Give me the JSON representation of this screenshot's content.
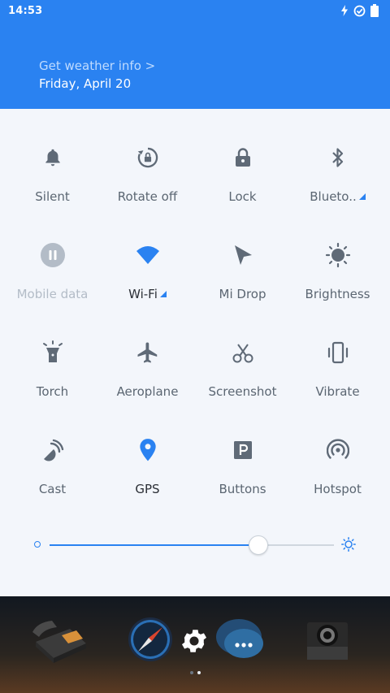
{
  "status_bar": {
    "time": "14:53"
  },
  "header": {
    "weather_link": "Get weather info >",
    "date": "Friday, April 20"
  },
  "tiles": [
    {
      "label": "Silent",
      "icon": "bell-icon",
      "state": "off"
    },
    {
      "label": "Rotate off",
      "icon": "rotate-lock-icon",
      "state": "off"
    },
    {
      "label": "Lock",
      "icon": "padlock-icon",
      "state": "off"
    },
    {
      "label": "Blueto..",
      "icon": "bluetooth-icon",
      "state": "off",
      "expandable": true
    },
    {
      "label": "Mobile data",
      "icon": "mobile-data-icon",
      "state": "disabled"
    },
    {
      "label": "Wi-Fi",
      "icon": "wifi-icon",
      "state": "on",
      "expandable": true
    },
    {
      "label": "Mi Drop",
      "icon": "mi-drop-icon",
      "state": "off"
    },
    {
      "label": "Brightness",
      "icon": "brightness-icon",
      "state": "off"
    },
    {
      "label": "Torch",
      "icon": "torch-icon",
      "state": "off"
    },
    {
      "label": "Aeroplane",
      "icon": "aeroplane-icon",
      "state": "off"
    },
    {
      "label": "Screenshot",
      "icon": "scissors-icon",
      "state": "off"
    },
    {
      "label": "Vibrate",
      "icon": "vibrate-icon",
      "state": "off"
    },
    {
      "label": "Cast",
      "icon": "cast-icon",
      "state": "off"
    },
    {
      "label": "GPS",
      "icon": "location-pin-icon",
      "state": "on"
    },
    {
      "label": "Buttons",
      "icon": "parking-p-icon",
      "state": "off"
    },
    {
      "label": "Hotspot",
      "icon": "hotspot-icon",
      "state": "off"
    }
  ],
  "brightness": {
    "level": 0.73
  },
  "colors": {
    "accent": "#2a82f1",
    "icon_gray": "#5f6a77",
    "disabled": "#b3bcc7",
    "header_bg": "#2a82f1",
    "panel_bg": "#f3f6fb"
  },
  "dock": {
    "apps": [
      "phone-icon",
      "compass-icon",
      "messages-icon",
      "camera-icon"
    ],
    "page": 2,
    "pages": 2
  }
}
